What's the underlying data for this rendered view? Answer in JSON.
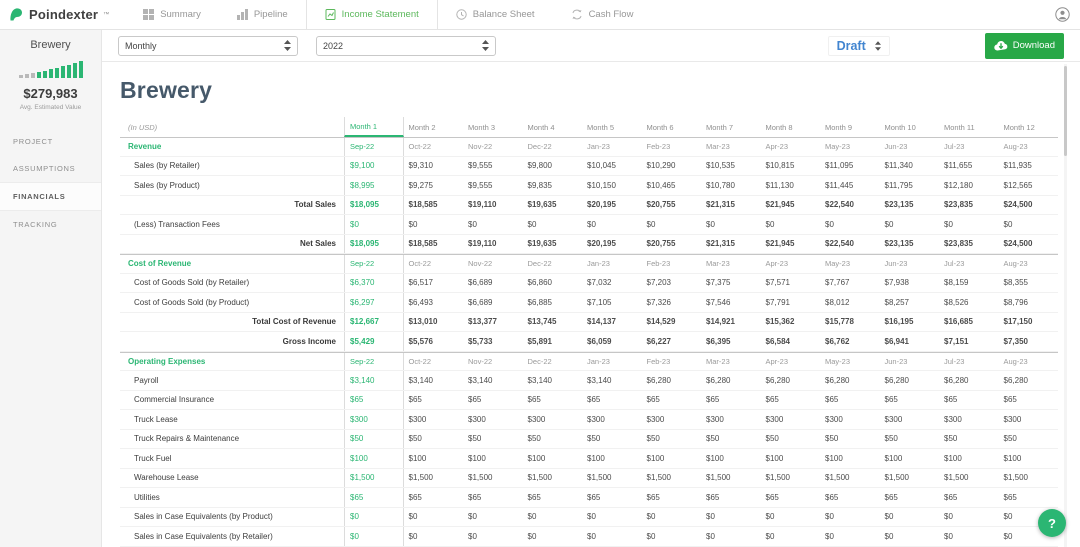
{
  "theme": {
    "green": "#2bb673",
    "tab-green": "#5cb85c",
    "draft-blue": "#4285d0",
    "button-green": "#28a847",
    "title-color": "#46596a"
  },
  "app": {
    "logo_text": "Poindexter",
    "logo_mark": "™"
  },
  "nav": {
    "tabs": [
      {
        "label": "Summary",
        "active": false
      },
      {
        "label": "Pipeline",
        "active": false
      },
      {
        "label": "Income Statement",
        "active": true
      },
      {
        "label": "Balance Sheet",
        "active": false
      },
      {
        "label": "Cash Flow",
        "active": false
      }
    ]
  },
  "sidebar": {
    "project_name": "Brewery",
    "value": "$279,983",
    "value_caption": "Avg. Estimated Value",
    "items": [
      {
        "label": "PROJECT",
        "active": false
      },
      {
        "label": "ASSUMPTIONS",
        "active": false
      },
      {
        "label": "FINANCIALS",
        "active": true
      },
      {
        "label": "TRACKING",
        "active": false
      }
    ]
  },
  "toolbar": {
    "period_value": "Monthly",
    "year_value": "2022",
    "status_value": "Draft",
    "download_label": "Download"
  },
  "fab": {
    "label": "?"
  },
  "main": {
    "title": "Brewery",
    "table": {
      "unit_label": "(In USD)",
      "selected_month": "Month 1",
      "month_headers": [
        "Month 1",
        "Month 2",
        "Month 3",
        "Month 4",
        "Month 5",
        "Month 6",
        "Month 7",
        "Month 8",
        "Month 9",
        "Month 10",
        "Month 11",
        "Month 12"
      ],
      "date_headers": [
        "Sep-22",
        "Oct-22",
        "Nov-22",
        "Dec-22",
        "Jan-23",
        "Feb-23",
        "Mar-23",
        "Apr-23",
        "May-23",
        "Jun-23",
        "Jul-23",
        "Aug-23"
      ],
      "rows": [
        {
          "type": "section",
          "label": "Revenue"
        },
        {
          "type": "item",
          "label": "Sales (by Retailer)",
          "values": [
            "$9,100",
            "$9,310",
            "$9,555",
            "$9,800",
            "$10,045",
            "$10,290",
            "$10,535",
            "$10,815",
            "$11,095",
            "$11,340",
            "$11,655",
            "$11,935"
          ]
        },
        {
          "type": "item",
          "label": "Sales (by Product)",
          "values": [
            "$8,995",
            "$9,275",
            "$9,555",
            "$9,835",
            "$10,150",
            "$10,465",
            "$10,780",
            "$11,130",
            "$11,445",
            "$11,795",
            "$12,180",
            "$12,565"
          ]
        },
        {
          "type": "total",
          "label": "Total Sales",
          "values": [
            "$18,095",
            "$18,585",
            "$19,110",
            "$19,635",
            "$20,195",
            "$20,755",
            "$21,315",
            "$21,945",
            "$22,540",
            "$23,135",
            "$23,835",
            "$24,500"
          ]
        },
        {
          "type": "item",
          "label": "(Less) Transaction Fees",
          "values": [
            "$0",
            "$0",
            "$0",
            "$0",
            "$0",
            "$0",
            "$0",
            "$0",
            "$0",
            "$0",
            "$0",
            "$0"
          ]
        },
        {
          "type": "total",
          "label": "Net Sales",
          "values": [
            "$18,095",
            "$18,585",
            "$19,110",
            "$19,635",
            "$20,195",
            "$20,755",
            "$21,315",
            "$21,945",
            "$22,540",
            "$23,135",
            "$23,835",
            "$24,500"
          ]
        },
        {
          "type": "section",
          "label": "Cost of Revenue"
        },
        {
          "type": "item",
          "label": "Cost of Goods Sold (by Retailer)",
          "values": [
            "$6,370",
            "$6,517",
            "$6,689",
            "$6,860",
            "$7,032",
            "$7,203",
            "$7,375",
            "$7,571",
            "$7,767",
            "$7,938",
            "$8,159",
            "$8,355"
          ]
        },
        {
          "type": "item",
          "label": "Cost of Goods Sold (by Product)",
          "values": [
            "$6,297",
            "$6,493",
            "$6,689",
            "$6,885",
            "$7,105",
            "$7,326",
            "$7,546",
            "$7,791",
            "$8,012",
            "$8,257",
            "$8,526",
            "$8,796"
          ]
        },
        {
          "type": "total",
          "label": "Total Cost of Revenue",
          "values": [
            "$12,667",
            "$13,010",
            "$13,377",
            "$13,745",
            "$14,137",
            "$14,529",
            "$14,921",
            "$15,362",
            "$15,778",
            "$16,195",
            "$16,685",
            "$17,150"
          ]
        },
        {
          "type": "total",
          "label": "Gross Income",
          "values": [
            "$5,429",
            "$5,576",
            "$5,733",
            "$5,891",
            "$6,059",
            "$6,227",
            "$6,395",
            "$6,584",
            "$6,762",
            "$6,941",
            "$7,151",
            "$7,350"
          ]
        },
        {
          "type": "section",
          "label": "Operating Expenses"
        },
        {
          "type": "item",
          "label": "Payroll",
          "values": [
            "$3,140",
            "$3,140",
            "$3,140",
            "$3,140",
            "$3,140",
            "$6,280",
            "$6,280",
            "$6,280",
            "$6,280",
            "$6,280",
            "$6,280",
            "$6,280"
          ]
        },
        {
          "type": "item",
          "label": "Commercial Insurance",
          "values": [
            "$65",
            "$65",
            "$65",
            "$65",
            "$65",
            "$65",
            "$65",
            "$65",
            "$65",
            "$65",
            "$65",
            "$65"
          ]
        },
        {
          "type": "item",
          "label": "Truck Lease",
          "values": [
            "$300",
            "$300",
            "$300",
            "$300",
            "$300",
            "$300",
            "$300",
            "$300",
            "$300",
            "$300",
            "$300",
            "$300"
          ]
        },
        {
          "type": "item",
          "label": "Truck Repairs & Maintenance",
          "values": [
            "$50",
            "$50",
            "$50",
            "$50",
            "$50",
            "$50",
            "$50",
            "$50",
            "$50",
            "$50",
            "$50",
            "$50"
          ]
        },
        {
          "type": "item",
          "label": "Truck Fuel",
          "values": [
            "$100",
            "$100",
            "$100",
            "$100",
            "$100",
            "$100",
            "$100",
            "$100",
            "$100",
            "$100",
            "$100",
            "$100"
          ]
        },
        {
          "type": "item",
          "label": "Warehouse Lease",
          "values": [
            "$1,500",
            "$1,500",
            "$1,500",
            "$1,500",
            "$1,500",
            "$1,500",
            "$1,500",
            "$1,500",
            "$1,500",
            "$1,500",
            "$1,500",
            "$1,500"
          ]
        },
        {
          "type": "item",
          "label": "Utilities",
          "values": [
            "$65",
            "$65",
            "$65",
            "$65",
            "$65",
            "$65",
            "$65",
            "$65",
            "$65",
            "$65",
            "$65",
            "$65"
          ]
        },
        {
          "type": "item",
          "label": "Sales in Case Equivalents (by Product)",
          "values": [
            "$0",
            "$0",
            "$0",
            "$0",
            "$0",
            "$0",
            "$0",
            "$0",
            "$0",
            "$0",
            "$0",
            "$0"
          ]
        },
        {
          "type": "item",
          "label": "Sales in Case Equivalents (by Retailer)",
          "values": [
            "$0",
            "$0",
            "$0",
            "$0",
            "$0",
            "$0",
            "$0",
            "$0",
            "$0",
            "$0",
            "$0",
            "$0"
          ]
        }
      ]
    }
  }
}
